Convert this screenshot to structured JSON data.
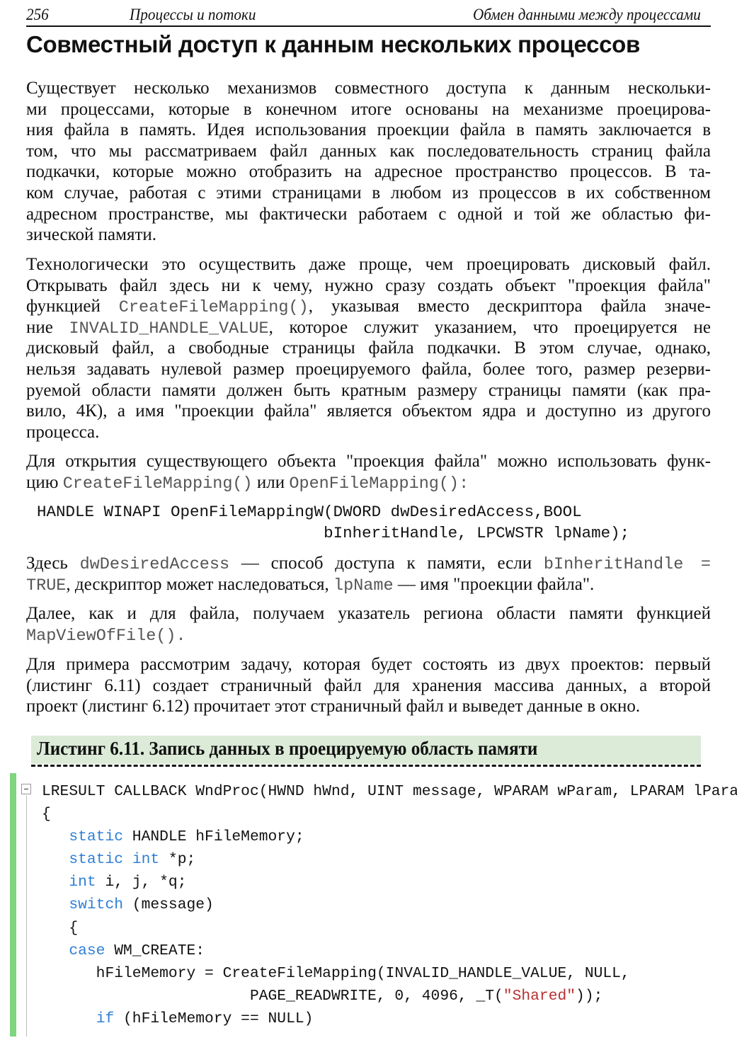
{
  "header": {
    "page_number": "256",
    "chapter": "Процессы и потоки",
    "section": "Обмен данными между процессами"
  },
  "title": "Совместный доступ к данным нескольких процессов",
  "paragraphs": [
    {
      "lines": [
        [
          {
            "t": "Существует несколько механизмов совместного доступа к данным нескольки-"
          }
        ],
        [
          {
            "t": "ми процессами, которые в конечном итоге основаны на механизме проецирова-"
          }
        ],
        [
          {
            "t": "ния файла в память. Идея использования проекции файла в память заключается в"
          }
        ],
        [
          {
            "t": "том, что мы рассматриваем файл данных как последовательность страниц файла"
          }
        ],
        [
          {
            "t": "подкачки, которые можно отобразить на адресное пространство процессов. В та-"
          }
        ],
        [
          {
            "t": "ком случае, работая с этими страницами в любом из процессов в их собственном"
          }
        ],
        [
          {
            "t": "адресном пространстве, мы фактически работаем с одной и той же областью фи-"
          }
        ],
        [
          {
            "t": "зической памяти."
          }
        ]
      ]
    },
    {
      "lines": [
        [
          {
            "t": "Технологически это осуществить даже проще, чем проецировать дисковый файл."
          }
        ],
        [
          {
            "t": "Открывать файл здесь ни к чему, нужно сразу создать объект \"проекция файла\""
          }
        ],
        [
          {
            "t": "функцией "
          },
          {
            "t": "CreateFileMapping()",
            "m": true
          },
          {
            "t": ", указывая вместо дескриптора файла значе-"
          }
        ],
        [
          {
            "t": "ние "
          },
          {
            "t": "INVALID_HANDLE_VALUE",
            "m": true
          },
          {
            "t": ", которое служит указанием, что проецируется не"
          }
        ],
        [
          {
            "t": "дисковый файл, а свободные страницы файла подкачки. В этом случае, однако,"
          }
        ],
        [
          {
            "t": "нельзя задавать нулевой размер проецируемого файла, более того, размер резерви-"
          }
        ],
        [
          {
            "t": "руемой области памяти должен быть кратным размеру страницы памяти (как пра-"
          }
        ],
        [
          {
            "t": "вило, 4К), а имя \"проекции файла\" является объектом ядра и доступно из другого"
          }
        ],
        [
          {
            "t": "процесса."
          }
        ]
      ]
    },
    {
      "lines": [
        [
          {
            "t": "Для открытия существующего объекта \"проекция файла\" можно использовать функ-"
          }
        ],
        [
          {
            "t": "цию "
          },
          {
            "t": "CreateFileMapping()",
            "m": true
          },
          {
            "t": " или "
          },
          {
            "t": "OpenFileMapping():",
            "m": true
          }
        ]
      ]
    },
    {
      "lines": [
        [
          {
            "t": "Здесь "
          },
          {
            "t": "dwDesiredAccess",
            "m": true
          },
          {
            "t": " — способ доступа к памяти, если "
          },
          {
            "t": "bInheritHandle =",
            "m": true
          }
        ],
        [
          {
            "t": "TRUE",
            "m": true
          },
          {
            "t": ", дескриптор может наследоваться, "
          },
          {
            "t": "lpName",
            "m": true
          },
          {
            "t": " — имя \"проекции файла\"."
          }
        ]
      ]
    },
    {
      "lines": [
        [
          {
            "t": "Далее, как и для файла, получаем указатель региона области памяти функцией"
          }
        ],
        [
          {
            "t": "MapViewOfFile().",
            "m": true
          }
        ]
      ]
    },
    {
      "lines": [
        [
          {
            "t": "Для примера рассмотрим задачу, которая будет состоять из двух проектов: первый"
          }
        ],
        [
          {
            "t": "(листинг 6.11) создает страничный файл для хранения массива данных, а второй"
          }
        ],
        [
          {
            "t": "проект (листинг 6.12) прочитает этот страничный файл и выведет данные в окно."
          }
        ]
      ]
    }
  ],
  "signature": [
    "HANDLE WINAPI OpenFileMappingW(DWORD dwDesiredAccess,BOOL",
    "                              bInheritHandle, LPCWSTR lpName);"
  ],
  "listing": {
    "title": "Листинг 6.11. Запись данных в проецируемую область памяти",
    "accent_color": "#7fd67f",
    "keyword_color": "#2f7fd6",
    "string_color": "#b83030",
    "lines": [
      [
        {
          "t": "LRESULT CALLBACK WndProc(HWND hWnd, UINT message, WPARAM wParam, LPARAM lParam)"
        }
      ],
      [
        {
          "t": "{"
        }
      ],
      [
        {
          "t": "   "
        },
        {
          "t": "static",
          "k": "kw"
        },
        {
          "t": " HANDLE hFileMemory;"
        }
      ],
      [
        {
          "t": "   "
        },
        {
          "t": "static",
          "k": "kw"
        },
        {
          "t": " "
        },
        {
          "t": "int",
          "k": "kw"
        },
        {
          "t": " *p;"
        }
      ],
      [
        {
          "t": "   "
        },
        {
          "t": "int",
          "k": "kw"
        },
        {
          "t": " i, j, *q;"
        }
      ],
      [
        {
          "t": "   "
        },
        {
          "t": "switch",
          "k": "kw"
        },
        {
          "t": " (message)"
        }
      ],
      [
        {
          "t": "   {"
        }
      ],
      [
        {
          "t": "   "
        },
        {
          "t": "case",
          "k": "kw"
        },
        {
          "t": " WM_CREATE:"
        }
      ],
      [
        {
          "t": "      hFileMemory = CreateFileMapping(INVALID_HANDLE_VALUE, NULL,"
        }
      ],
      [
        {
          "t": "                       PAGE_READWRITE, 0, 4096, _T("
        },
        {
          "t": "\"Shared\"",
          "k": "str"
        },
        {
          "t": "));"
        }
      ],
      [
        {
          "t": "      "
        },
        {
          "t": "if",
          "k": "kw"
        },
        {
          "t": " (hFileMemory == NULL)"
        }
      ]
    ]
  }
}
